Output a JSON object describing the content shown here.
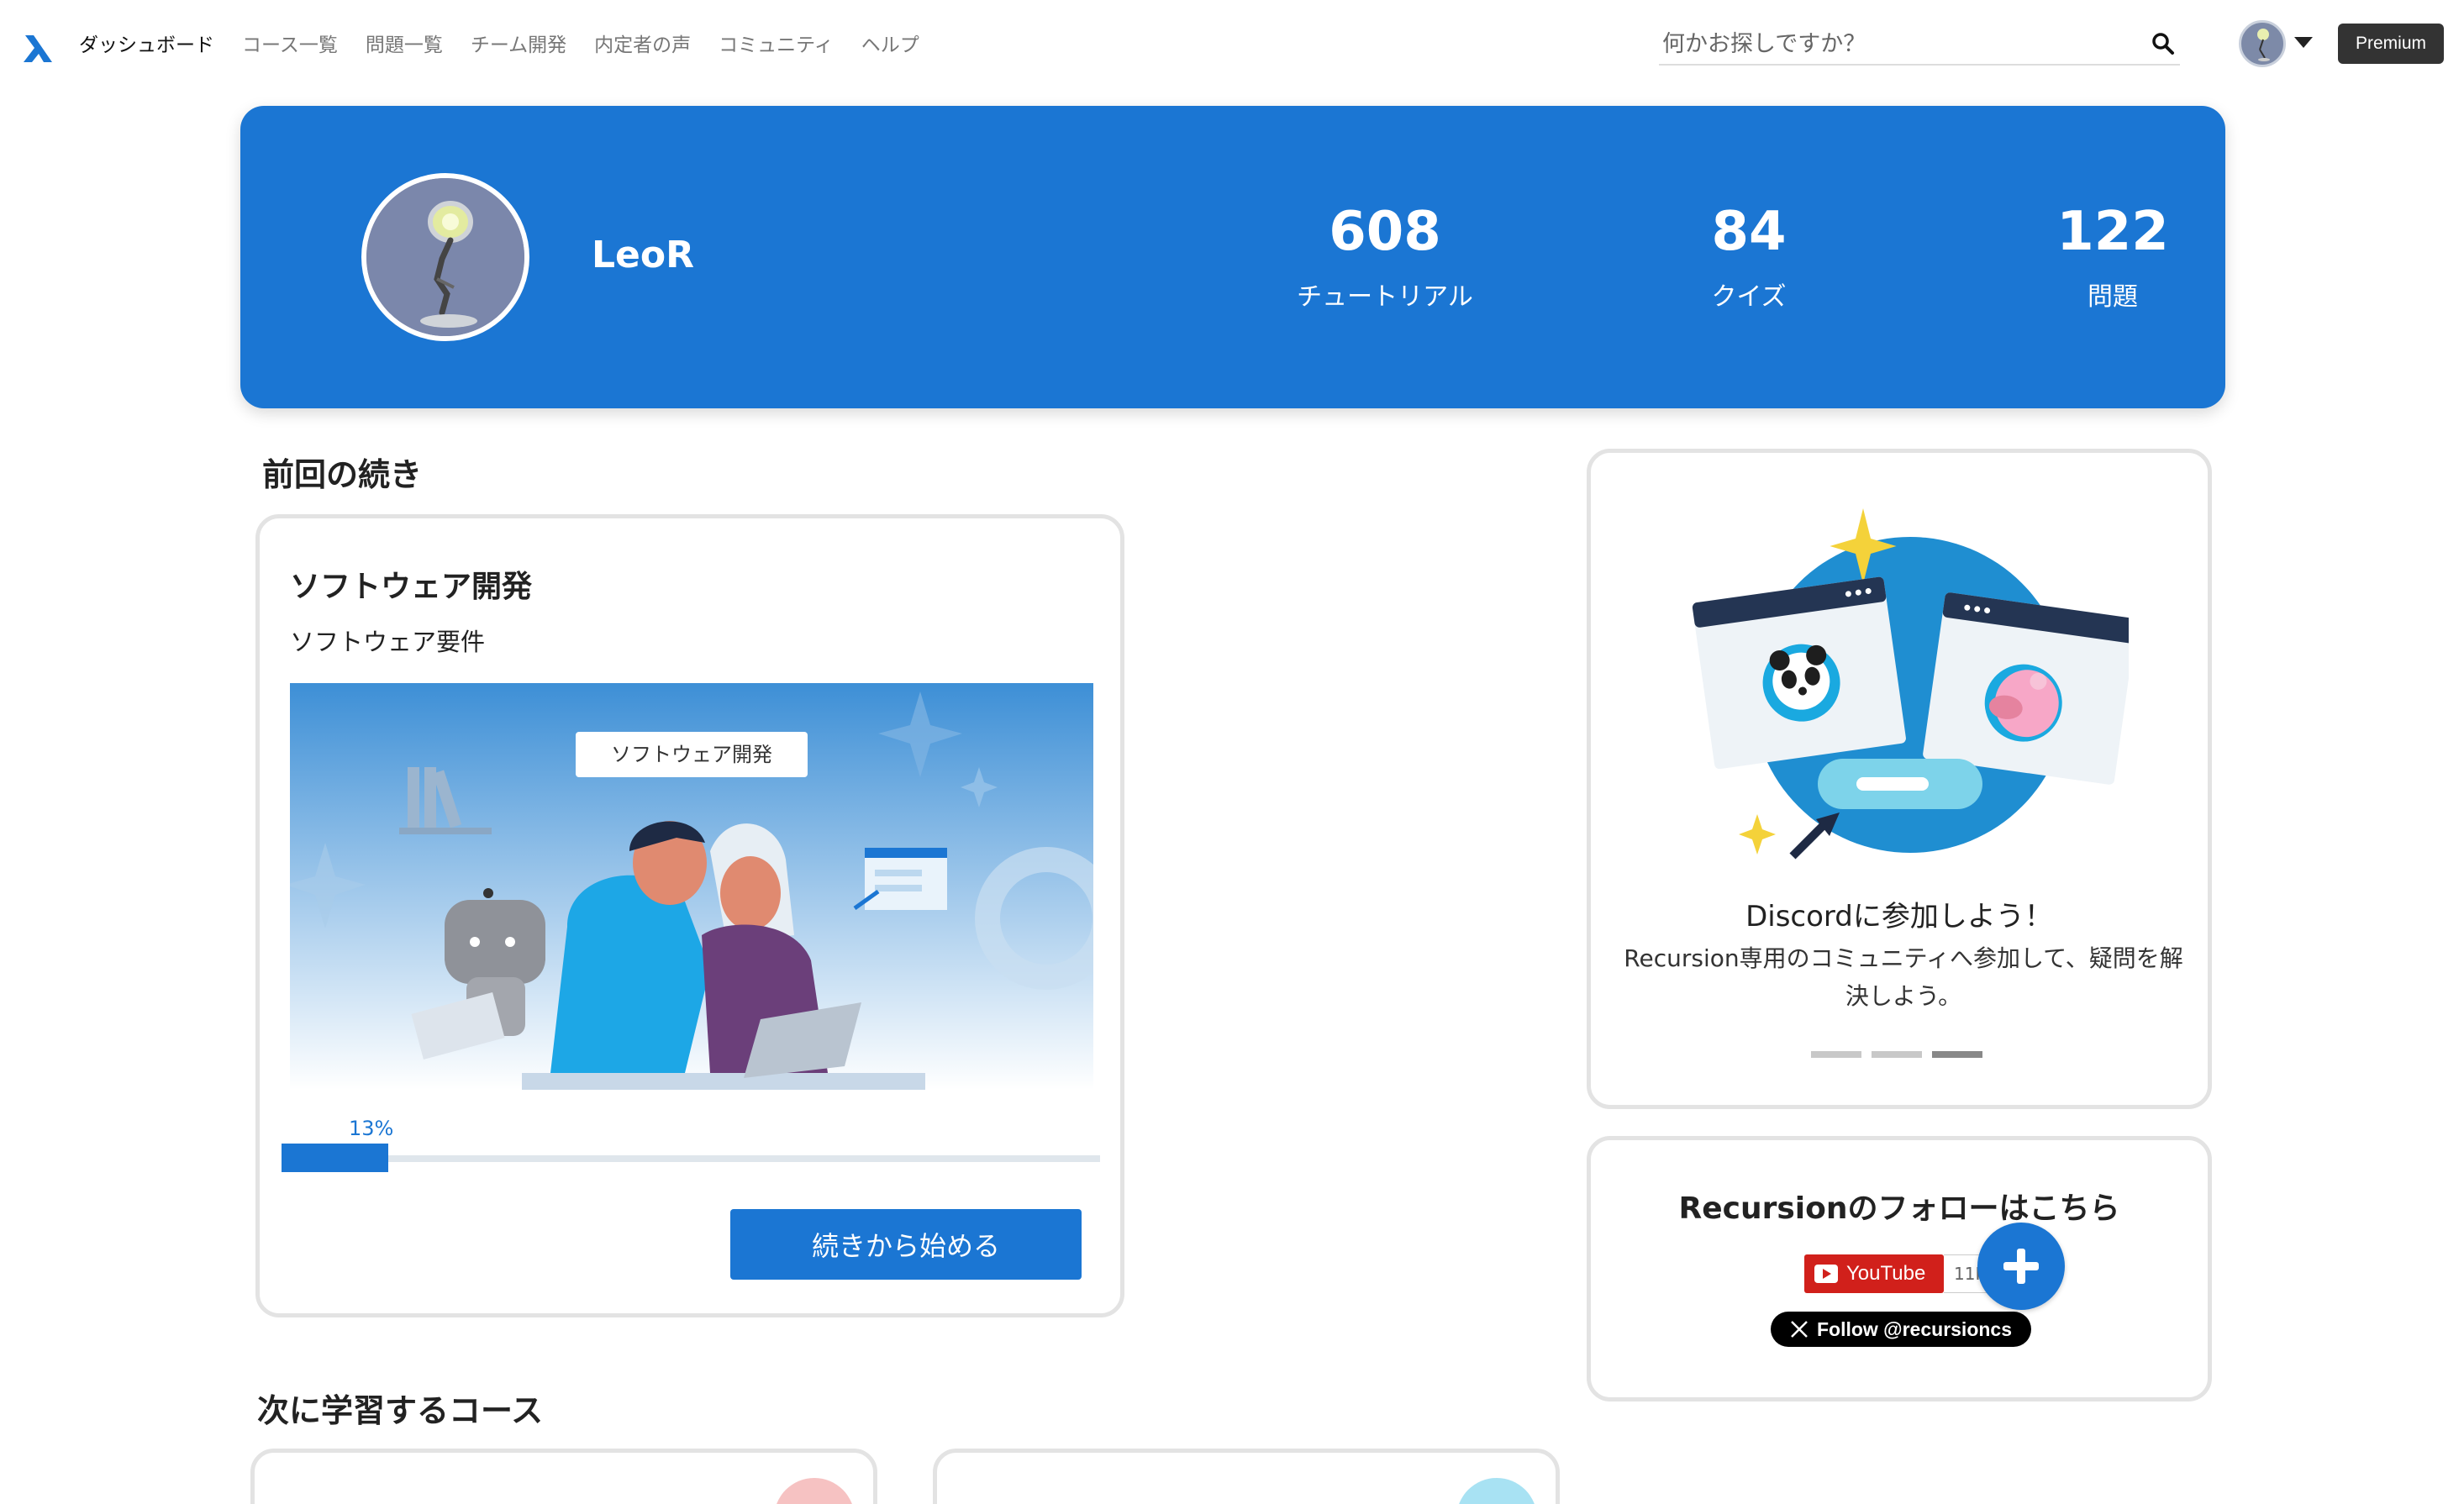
{
  "nav": {
    "links": [
      "ダッシュボード",
      "コース一覧",
      "問題一覧",
      "チーム開発",
      "内定者の声",
      "コミュニティ",
      "ヘルプ"
    ],
    "active_index": 0,
    "search_placeholder": "何かお探しですか？",
    "premium_label": "Premium"
  },
  "profile": {
    "name": "LeoR",
    "stats": [
      {
        "value": "608",
        "label": "チュートリアル"
      },
      {
        "value": "84",
        "label": "クイズ"
      },
      {
        "value": "122",
        "label": "問題"
      }
    ]
  },
  "continue": {
    "section_title": "前回の続き",
    "course_title": "ソフトウェア開発",
    "lesson_title": "ソフトウェア要件",
    "image_caption": "ソフトウェア開発",
    "progress_label": "13%",
    "progress_value": 0.13,
    "button_label": "続きから始める"
  },
  "discord": {
    "title": "Discordに参加しよう！",
    "description": "Recursion専用のコミュニティへ参加して、疑問を解決しよう。",
    "carousel_active_index": 2,
    "carousel_count": 3
  },
  "follow": {
    "title": "Recursionのフォローはこちら",
    "youtube_label": "YouTube",
    "youtube_count": "11K",
    "x_label": "Follow @recursioncs"
  },
  "next": {
    "section_title": "次に学習するコース"
  },
  "colors": {
    "primary": "#1b76d3",
    "premium_bg": "#333333",
    "youtube": "#d1201b"
  }
}
